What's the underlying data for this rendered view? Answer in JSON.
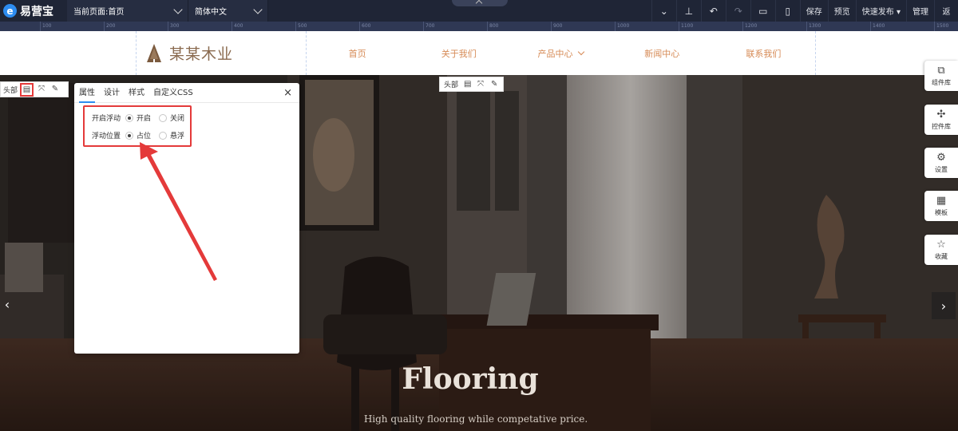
{
  "topbar": {
    "logo_mark": "e",
    "logo_text": "易营宝",
    "current_page": "当前页面:首页",
    "language": "简体中文",
    "tools": {
      "collapse_icon": "chevron-down-icon",
      "layers_icon": "layers-icon",
      "undo": "↶",
      "redo": "↷",
      "desktop": "▭",
      "mobile": "▯",
      "save": "保存",
      "preview": "预览",
      "publish": "快速发布 ▾",
      "manage": "管理",
      "more": "返"
    }
  },
  "ruler": {
    "ticks": [
      "100",
      "200",
      "300",
      "400",
      "500",
      "600",
      "700",
      "800",
      "900",
      "1000",
      "1100",
      "1200",
      "1300",
      "1400",
      "1500"
    ]
  },
  "site": {
    "brand": "某某木业",
    "nav": [
      "首页",
      "关于我们",
      "产品中心",
      "新闻中心",
      "联系我们"
    ]
  },
  "header_toolbar": {
    "label": "头部",
    "icons": [
      "settings-icon",
      "expand-icon",
      "palette-icon"
    ]
  },
  "left_toolbar": {
    "label": "头部"
  },
  "panel": {
    "tabs": [
      "属性",
      "设计",
      "样式",
      "自定义CSS"
    ],
    "close": "×",
    "rows": [
      {
        "label": "开启浮动",
        "options": [
          "开启",
          "关闭"
        ],
        "selected": 0
      },
      {
        "label": "浮动位置",
        "options": [
          "占位",
          "悬浮"
        ],
        "selected": 0
      }
    ]
  },
  "hero": {
    "title": "Flooring",
    "subtitle": "High quality flooring while competative price.",
    "prev": "‹",
    "next": "›"
  },
  "sidebar": [
    {
      "icon": "component-library-icon",
      "glyph": "⧉",
      "label": "组件库"
    },
    {
      "icon": "widget-library-icon",
      "glyph": "✣",
      "label": "控件库"
    },
    {
      "icon": "settings-icon",
      "glyph": "⚙",
      "label": "设置"
    },
    {
      "icon": "template-icon",
      "glyph": "▦",
      "label": "模板"
    },
    {
      "icon": "favorite-icon",
      "glyph": "☆",
      "label": "收藏"
    }
  ],
  "colors": {
    "topbar": "#1f2536",
    "accent_nav": "#d68a55",
    "highlight": "#e43a3a",
    "tab_active": "#2d8cf0"
  }
}
